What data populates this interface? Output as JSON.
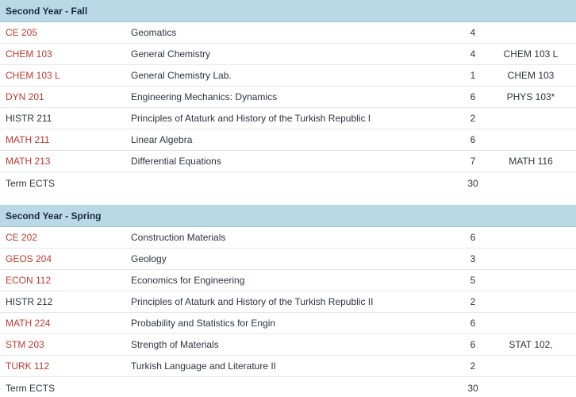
{
  "terms": [
    {
      "title": "Second Year - Fall",
      "courses": [
        {
          "code": "CE 205",
          "name": "Geomatics",
          "ects": "4",
          "prereq": "",
          "link": true
        },
        {
          "code": "CHEM 103",
          "name": "General Chemistry",
          "ects": "4",
          "prereq": "CHEM 103  L",
          "link": true
        },
        {
          "code": "CHEM 103  L",
          "name": "General Chemistry Lab.",
          "ects": "1",
          "prereq": "CHEM 103",
          "link": true
        },
        {
          "code": "DYN 201",
          "name": "Engineering Mechanics: Dynamics",
          "ects": "6",
          "prereq": "PHYS 103*",
          "link": true
        },
        {
          "code": "HISTR 211",
          "name": "Principles of Ataturk and History of the Turkish Republic I",
          "ects": "2",
          "prereq": "",
          "link": false
        },
        {
          "code": "MATH 211",
          "name": "Linear Algebra",
          "ects": "6",
          "prereq": "",
          "link": true
        },
        {
          "code": "MATH 213",
          "name": "Differential Equations",
          "ects": "7",
          "prereq": "MATH 116",
          "link": true
        }
      ],
      "total_label": "Term ECTS",
      "total_value": "30"
    },
    {
      "title": "Second Year - Spring",
      "courses": [
        {
          "code": "CE 202",
          "name": "Construction Materials",
          "ects": "6",
          "prereq": "",
          "link": true
        },
        {
          "code": "GEOS 204",
          "name": "Geology",
          "ects": "3",
          "prereq": "",
          "link": true
        },
        {
          "code": "ECON 112",
          "name": "Economics for Engineering",
          "ects": "5",
          "prereq": "",
          "link": true
        },
        {
          "code": "HISTR 212",
          "name": "Principles of Ataturk and History of the Turkish Republic II",
          "ects": "2",
          "prereq": "",
          "link": false
        },
        {
          "code": "MATH 224",
          "name": "Probability and Statistics for Engin",
          "ects": "6",
          "prereq": "",
          "link": true
        },
        {
          "code": "STM 203",
          "name": "Strength of Materials",
          "ects": "6",
          "prereq": "STAT 102,",
          "link": true
        },
        {
          "code": "TURK 112",
          "name": "Turkish Language and Literature II",
          "ects": "2",
          "prereq": "",
          "link": true
        }
      ],
      "total_label": "Term ECTS",
      "total_value": "30"
    }
  ],
  "colors": {
    "header_bg": "#b9d9e6",
    "link": "#c0392b",
    "text": "#2d3440"
  }
}
